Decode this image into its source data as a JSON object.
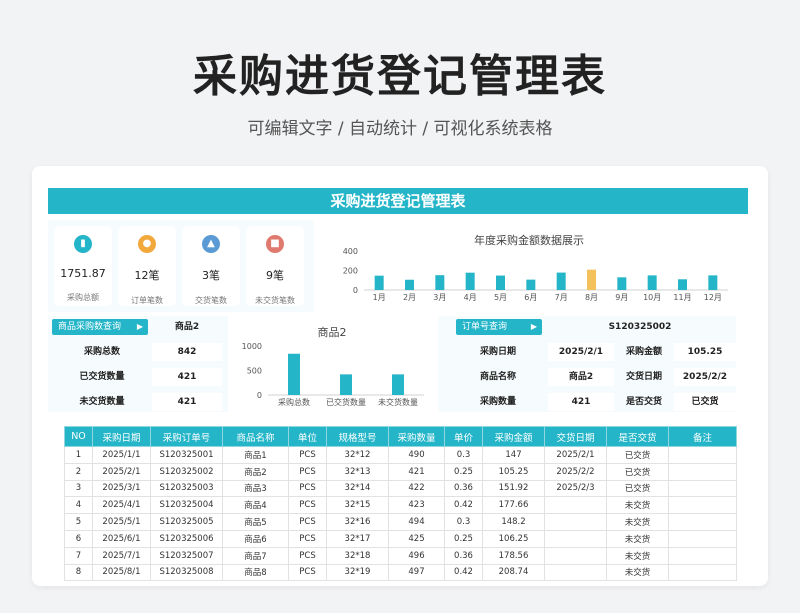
{
  "header": {
    "title": "采购进货登记管理表",
    "subtitle": "可编辑文字  /  自动统计  /  可视化系统表格"
  },
  "sheet": {
    "banner": "采购进货登记管理表",
    "kpis": [
      {
        "value": "1751.87",
        "label": "采购总额",
        "icon": "chart-icon",
        "color": "#24b5c8"
      },
      {
        "value": "12笔",
        "label": "订单笔数",
        "icon": "coin-icon",
        "color": "#f2a93b"
      },
      {
        "value": "3笔",
        "label": "交货笔数",
        "icon": "delivery-icon",
        "color": "#5b9bd5"
      },
      {
        "value": "9笔",
        "label": "未交货笔数",
        "icon": "calendar-icon",
        "color": "#e07a6e"
      }
    ],
    "product_query": {
      "tag": "商品采购数查询",
      "product": "商品2",
      "rows": [
        {
          "label": "采购总数",
          "value": "842"
        },
        {
          "label": "已交货数量",
          "value": "421"
        },
        {
          "label": "未交货数量",
          "value": "421"
        }
      ]
    },
    "order_query": {
      "tag": "订单号查询",
      "order_no": "S120325002",
      "fields": {
        "date_label": "采购日期",
        "date_value": "2025/2/1",
        "amount_label": "采购金额",
        "amount_value": "105.25",
        "name_label": "商品名称",
        "name_value": "商品2",
        "deliver_date_label": "交货日期",
        "deliver_date_value": "2025/2/2",
        "qty_label": "采购数量",
        "qty_value": "421",
        "delivered_label": "是否交货",
        "delivered_value": "已交货"
      }
    },
    "table": {
      "headers": [
        "NO",
        "采购日期",
        "采购订单号",
        "商品名称",
        "单位",
        "规格型号",
        "采购数量",
        "单价",
        "采购金额",
        "交货日期",
        "是否交货",
        "备注"
      ],
      "rows": [
        [
          "1",
          "2025/1/1",
          "S120325001",
          "商品1",
          "PCS",
          "32*12",
          "490",
          "0.3",
          "147",
          "2025/2/1",
          "已交货",
          ""
        ],
        [
          "2",
          "2025/2/1",
          "S120325002",
          "商品2",
          "PCS",
          "32*13",
          "421",
          "0.25",
          "105.25",
          "2025/2/2",
          "已交货",
          ""
        ],
        [
          "3",
          "2025/3/1",
          "S120325003",
          "商品3",
          "PCS",
          "32*14",
          "422",
          "0.36",
          "151.92",
          "2025/2/3",
          "已交货",
          ""
        ],
        [
          "4",
          "2025/4/1",
          "S120325004",
          "商品4",
          "PCS",
          "32*15",
          "423",
          "0.42",
          "177.66",
          "",
          "未交货",
          ""
        ],
        [
          "5",
          "2025/5/1",
          "S120325005",
          "商品5",
          "PCS",
          "32*16",
          "494",
          "0.3",
          "148.2",
          "",
          "未交货",
          ""
        ],
        [
          "6",
          "2025/6/1",
          "S120325006",
          "商品6",
          "PCS",
          "32*17",
          "425",
          "0.25",
          "106.25",
          "",
          "未交货",
          ""
        ],
        [
          "7",
          "2025/7/1",
          "S120325007",
          "商品7",
          "PCS",
          "32*18",
          "496",
          "0.36",
          "178.56",
          "",
          "未交货",
          ""
        ],
        [
          "8",
          "2025/8/1",
          "S120325008",
          "商品8",
          "PCS",
          "32*19",
          "497",
          "0.42",
          "208.74",
          "",
          "未交货",
          ""
        ]
      ]
    }
  },
  "chart_data": [
    {
      "type": "bar",
      "title": "年度采购金额数据展示",
      "categories": [
        "1月",
        "2月",
        "3月",
        "4月",
        "5月",
        "6月",
        "7月",
        "8月",
        "9月",
        "10月",
        "11月",
        "12月"
      ],
      "values": [
        147,
        105.25,
        151.92,
        177.66,
        148.2,
        106.25,
        178.56,
        208.74,
        130,
        150,
        110,
        150
      ],
      "highlight_index": 7,
      "ylim": [
        0,
        400
      ],
      "yticks": [
        0,
        200,
        400
      ],
      "colors": {
        "bar": "#24b5c8",
        "highlight": "#f5c15c"
      }
    },
    {
      "type": "bar",
      "title": "商品2",
      "categories": [
        "采购总数",
        "已交货数量",
        "未交货数量"
      ],
      "values": [
        842,
        421,
        421
      ],
      "ylim": [
        0,
        1000
      ],
      "yticks": [
        0,
        500,
        1000
      ],
      "colors": {
        "bar": "#24b5c8"
      }
    }
  ]
}
